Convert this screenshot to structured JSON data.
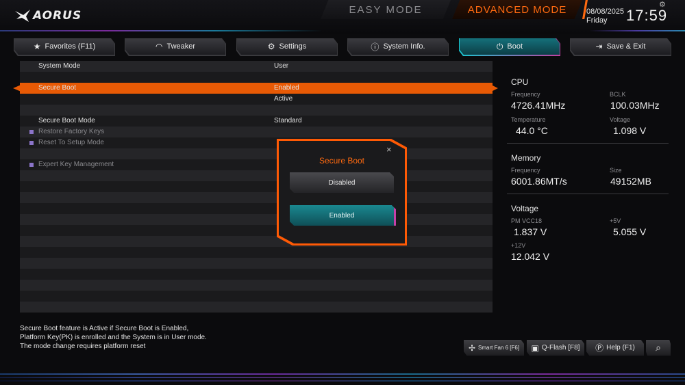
{
  "header": {
    "logo_text": "AORUS",
    "easy_mode_label": "EASY MODE",
    "advanced_mode_label": "ADVANCED MODE",
    "date": "08/08/2025",
    "day": "Friday",
    "time": "17:59"
  },
  "tabs": [
    {
      "label": "Favorites (F11)",
      "icon": "star-folder-icon",
      "active": false
    },
    {
      "label": "Tweaker",
      "icon": "speedometer-icon",
      "active": false
    },
    {
      "label": "Settings",
      "icon": "gear-icon",
      "active": false
    },
    {
      "label": "System Info.",
      "icon": "info-icon",
      "active": false
    },
    {
      "label": "Boot",
      "icon": "power-icon",
      "active": true
    },
    {
      "label": "Save & Exit",
      "icon": "exit-icon",
      "active": false
    }
  ],
  "settings_rows": [
    {
      "label": "System Mode",
      "value": "User"
    },
    {
      "label": "",
      "value": ""
    },
    {
      "label": "Secure Boot",
      "value": "Enabled",
      "selected": true
    },
    {
      "label": "",
      "value": "Active"
    },
    {
      "label": "",
      "value": ""
    },
    {
      "label": "Secure Boot Mode",
      "value": "Standard"
    },
    {
      "label": "Restore Factory Keys",
      "value": "",
      "bullet": true,
      "disabled": true
    },
    {
      "label": "Reset To Setup Mode",
      "value": "",
      "bullet": true,
      "disabled": true
    },
    {
      "label": "",
      "value": ""
    },
    {
      "label": "Expert Key Management",
      "value": "",
      "bullet": true,
      "disabled": true
    }
  ],
  "popup": {
    "title": "Secure Boot",
    "close_glyph": "×",
    "option_disabled": "Disabled",
    "option_enabled": "Enabled",
    "selected": "Enabled"
  },
  "info_panel": {
    "cpu": {
      "heading": "CPU",
      "frequency_label": "Frequency",
      "frequency": "4726.41MHz",
      "bclk_label": "BCLK",
      "bclk": "100.03MHz",
      "temperature_label": "Temperature",
      "temperature": "44.0 °C",
      "voltage_label": "Voltage",
      "voltage": "1.098 V"
    },
    "memory": {
      "heading": "Memory",
      "frequency_label": "Frequency",
      "frequency": "6001.86MT/s",
      "size_label": "Size",
      "size": "49152MB"
    },
    "voltage": {
      "heading": "Voltage",
      "pm_vcc18_label": "PM VCC18",
      "pm_vcc18": "1.837 V",
      "plus5v_label": "+5V",
      "plus5v": "5.055 V",
      "plus12v_label": "+12V",
      "plus12v": "12.042 V"
    }
  },
  "help_text": {
    "line1": "Secure Boot feature is Active if Secure Boot is Enabled,",
    "line2": "Platform Key(PK) is enrolled and the System is in User mode.",
    "line3": "The mode change requires platform reset"
  },
  "footer_buttons": {
    "smart_fan": "Smart Fan 6 [F6]",
    "qflash": "Q-Flash [F8]",
    "help": "Help (F1)"
  },
  "colors": {
    "accent_orange": "#ff6a10",
    "selected_row": "#e85a05",
    "active_tab_teal": "#15707a",
    "active_tab_magenta": "#c23fa0"
  }
}
